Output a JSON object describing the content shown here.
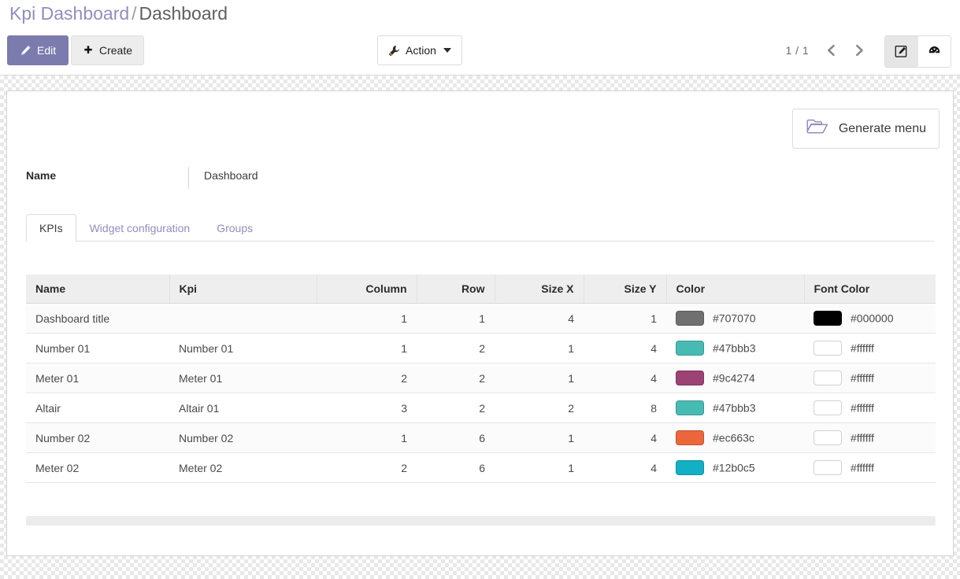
{
  "breadcrumb": {
    "root": "Kpi Dashboard",
    "separator": "/",
    "current": "Dashboard"
  },
  "toolbar": {
    "edit_label": "Edit",
    "create_label": "Create",
    "action_label": "Action",
    "edit_icon": "pencil-icon",
    "create_icon": "plus-icon",
    "action_icon": "wrench-icon",
    "caret_icon": "caret-down-icon"
  },
  "pager": {
    "value": "1 / 1",
    "prev_icon": "chevron-left-icon",
    "next_icon": "chevron-right-icon"
  },
  "view_switcher": {
    "form_icon": "pencil-square-icon",
    "form_label": "Form",
    "dashboard_icon": "gauge-icon",
    "dashboard_label": "Dashboard"
  },
  "sheet": {
    "generate_menu_label": "Generate menu",
    "generate_menu_icon": "folder-open-icon",
    "name_label": "Name",
    "name_value": "Dashboard"
  },
  "notebook": {
    "tabs": [
      {
        "label": "KPIs",
        "active": true
      },
      {
        "label": "Widget configuration",
        "active": false
      },
      {
        "label": "Groups",
        "active": false
      }
    ]
  },
  "table": {
    "headers": {
      "name": "Name",
      "kpi": "Kpi",
      "column": "Column",
      "row": "Row",
      "size_x": "Size X",
      "size_y": "Size Y",
      "color": "Color",
      "font_color": "Font Color"
    },
    "rows": [
      {
        "name": "Dashboard title",
        "kpi": "",
        "column": "1",
        "row": "1",
        "size_x": "4",
        "size_y": "1",
        "color": "#707070",
        "font_color": "#000000"
      },
      {
        "name": "Number 01",
        "kpi": "Number 01",
        "column": "1",
        "row": "2",
        "size_x": "1",
        "size_y": "4",
        "color": "#47bbb3",
        "font_color": "#ffffff"
      },
      {
        "name": "Meter 01",
        "kpi": "Meter 01",
        "column": "2",
        "row": "2",
        "size_x": "1",
        "size_y": "4",
        "color": "#9c4274",
        "font_color": "#ffffff"
      },
      {
        "name": "Altair",
        "kpi": "Altair 01",
        "column": "3",
        "row": "2",
        "size_x": "2",
        "size_y": "8",
        "color": "#47bbb3",
        "font_color": "#ffffff"
      },
      {
        "name": "Number 02",
        "kpi": "Number 02",
        "column": "1",
        "row": "6",
        "size_x": "1",
        "size_y": "4",
        "color": "#ec663c",
        "font_color": "#ffffff"
      },
      {
        "name": "Meter 02",
        "kpi": "Meter 02",
        "column": "2",
        "row": "6",
        "size_x": "1",
        "size_y": "4",
        "color": "#12b0c5",
        "font_color": "#ffffff"
      }
    ]
  },
  "theme": {
    "accent": "#7c7bad",
    "link": "#8f8fbf",
    "header_bg": "#eeeeee"
  }
}
